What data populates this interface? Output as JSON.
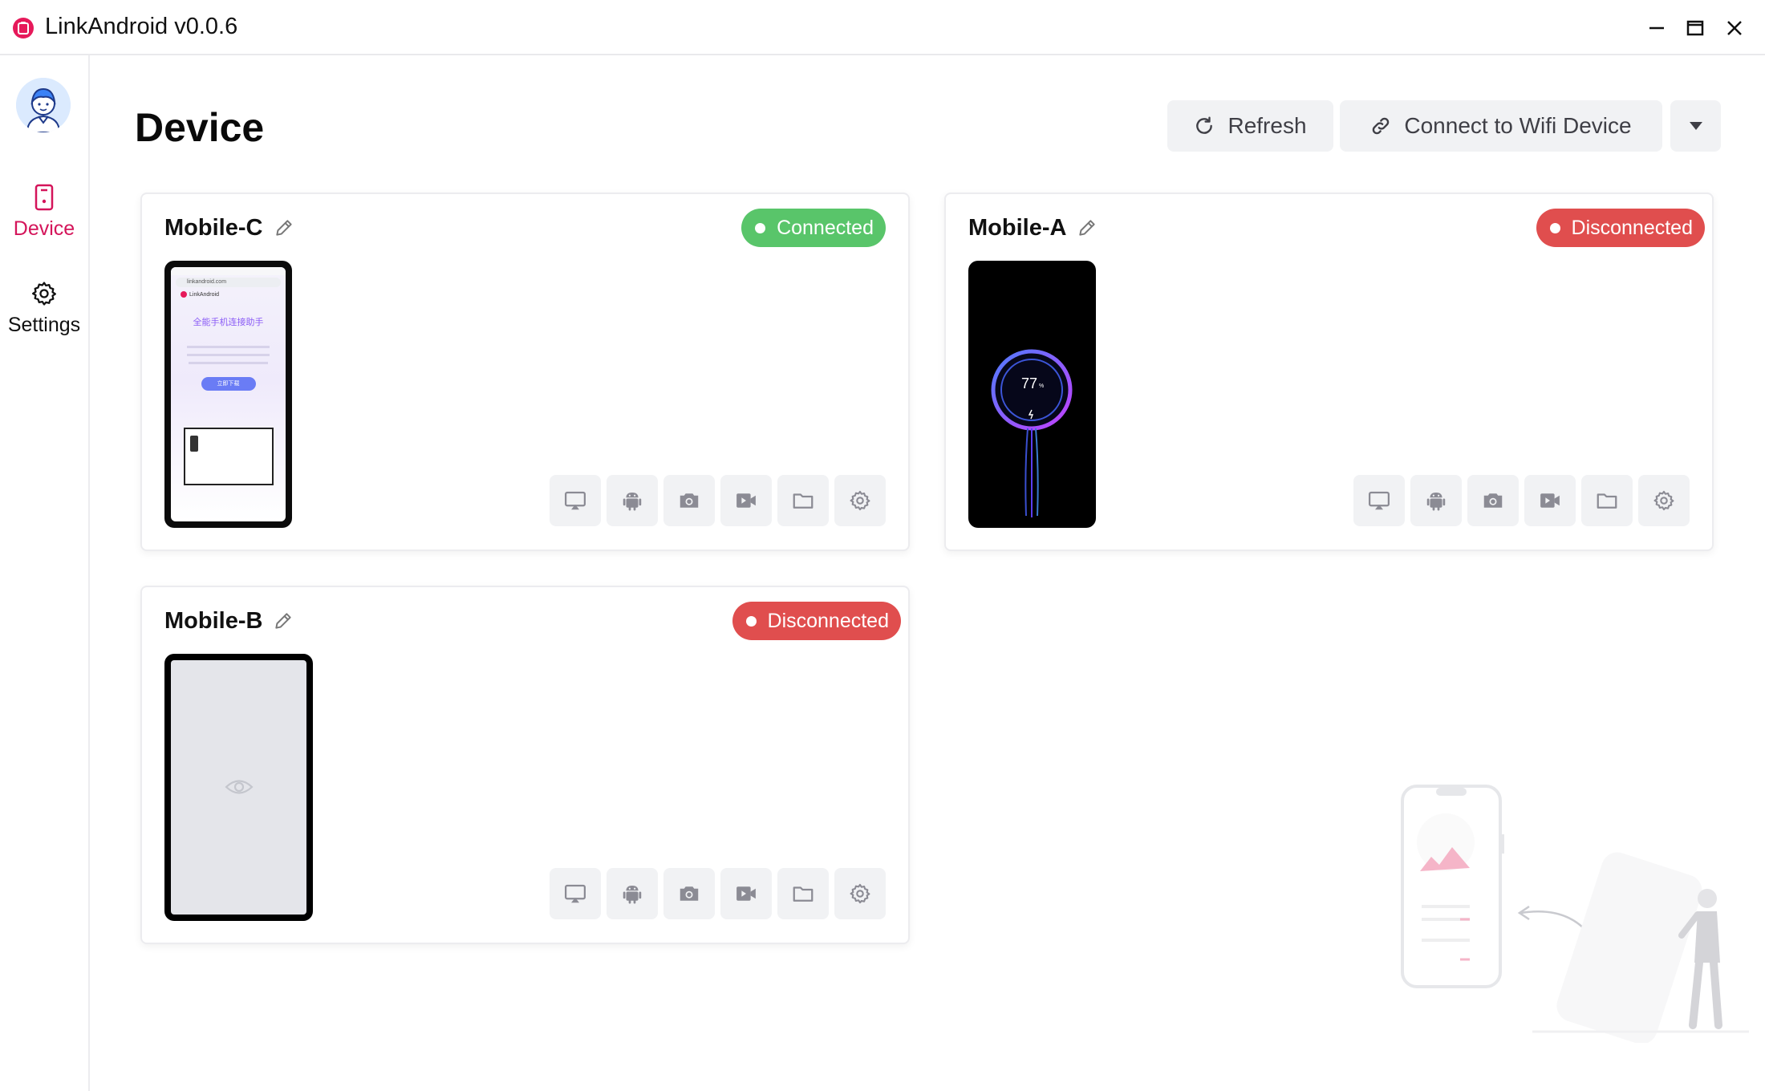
{
  "window": {
    "title": "LinkAndroid v0.0.6",
    "controls": [
      "minimize",
      "maximize",
      "close"
    ]
  },
  "sidebar": {
    "items": [
      {
        "label": "Device",
        "icon": "phone-icon",
        "active": true
      },
      {
        "label": "Settings",
        "icon": "gear-icon",
        "active": false
      }
    ]
  },
  "header": {
    "title": "Device",
    "refresh_label": "Refresh",
    "wifi_label": "Connect to Wifi Device"
  },
  "devices": [
    {
      "name": "Mobile-C",
      "status": "Connected",
      "screen": {
        "url": "linkandroid.com",
        "brand": "LinkAndroid",
        "headline": "全能手机连接助手",
        "download": "立即下载"
      }
    },
    {
      "name": "Mobile-A",
      "status": "Disconnected",
      "screen": {
        "battery": "77"
      }
    },
    {
      "name": "Mobile-B",
      "status": "Disconnected"
    }
  ],
  "actions": [
    "mirror-screen-icon",
    "android-icon",
    "camera-icon",
    "video-icon",
    "folder-icon",
    "gear-icon"
  ],
  "colors": {
    "accent": "#d4145a",
    "connected": "#59c56a",
    "disconnected": "#e04e4e",
    "button_bg": "#f1f2f4"
  }
}
